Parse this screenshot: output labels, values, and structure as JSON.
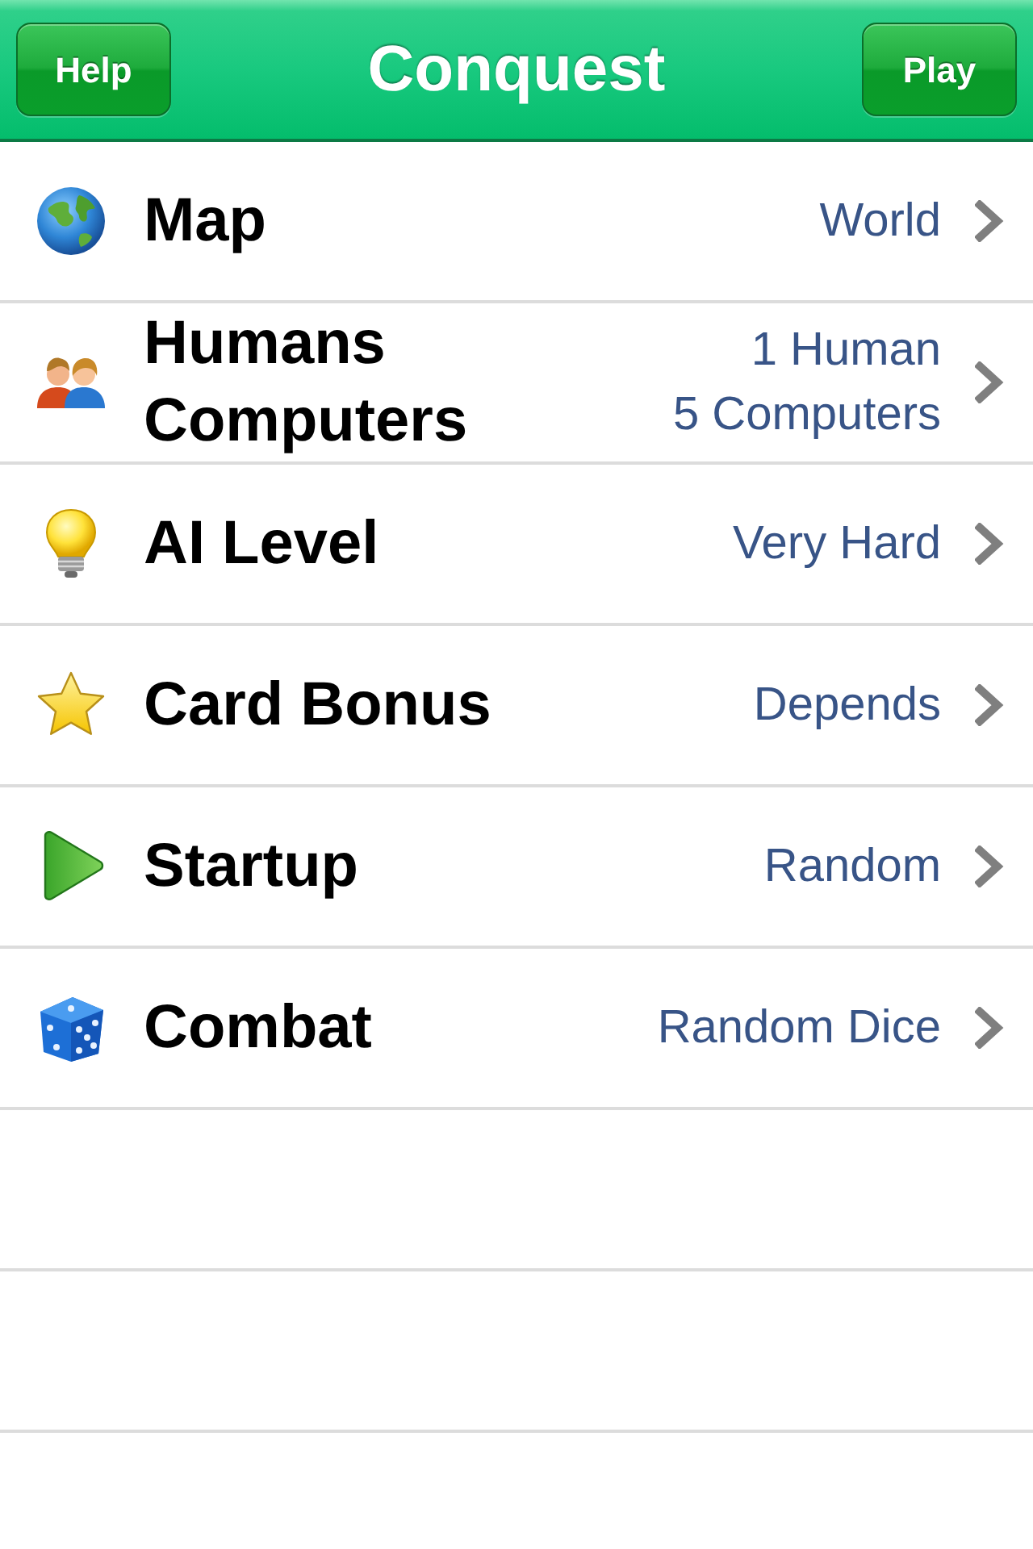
{
  "navbar": {
    "title": "Conquest",
    "left_button": "Help",
    "right_button": "Play"
  },
  "rows": [
    {
      "kind": "globe",
      "labels": [
        "Map"
      ],
      "values": [
        "World"
      ]
    },
    {
      "kind": "people",
      "labels": [
        "Humans",
        "Computers"
      ],
      "values": [
        "1 Human",
        "5 Computers"
      ]
    },
    {
      "kind": "bulb",
      "labels": [
        "AI Level"
      ],
      "values": [
        "Very Hard"
      ]
    },
    {
      "kind": "star",
      "labels": [
        "Card Bonus"
      ],
      "values": [
        "Depends"
      ]
    },
    {
      "kind": "play",
      "labels": [
        "Startup"
      ],
      "values": [
        "Random"
      ]
    },
    {
      "kind": "dice",
      "labels": [
        "Combat"
      ],
      "values": [
        "Random Dice"
      ]
    }
  ]
}
